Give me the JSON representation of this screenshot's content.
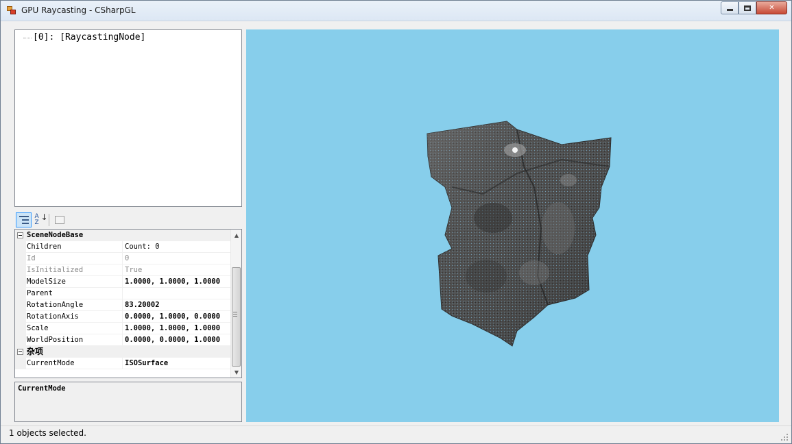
{
  "window": {
    "title": "GPU Raycasting - CSharpGL",
    "minimize_label": "",
    "maximize_label": "",
    "close_label": "✕"
  },
  "tree": {
    "node_label": "[0]: [RaycastingNode]"
  },
  "toolbar": {
    "categorized_icon": "categorized-icon",
    "alphabetical_icon": "alphabetical-sort-icon",
    "property_pages_icon": "property-pages-icon",
    "alphabetical_a": "A",
    "alphabetical_z": "Z",
    "alphabetical_arrow": "↓"
  },
  "property_grid": {
    "categories": [
      {
        "name": "SceneNodeBase",
        "rows": [
          {
            "name": "Children",
            "value": "Count: 0",
            "readonly": false,
            "bold": false
          },
          {
            "name": "Id",
            "value": "0",
            "readonly": true,
            "bold": false
          },
          {
            "name": "IsInitialized",
            "value": "True",
            "readonly": true,
            "bold": false
          },
          {
            "name": "ModelSize",
            "value": "1.0000, 1.0000, 1.0000",
            "readonly": false,
            "bold": true
          },
          {
            "name": "Parent",
            "value": "",
            "readonly": false,
            "bold": false
          },
          {
            "name": "RotationAngle",
            "value": "83.20002",
            "readonly": false,
            "bold": true
          },
          {
            "name": "RotationAxis",
            "value": "0.0000, 1.0000, 0.0000",
            "readonly": false,
            "bold": true
          },
          {
            "name": "Scale",
            "value": "1.0000, 1.0000, 1.0000",
            "readonly": false,
            "bold": true
          },
          {
            "name": "WorldPosition",
            "value": "0.0000, 0.0000, 1.0000",
            "readonly": false,
            "bold": true
          }
        ]
      },
      {
        "name": "杂项",
        "rows": [
          {
            "name": "CurrentMode",
            "value": "ISOSurface",
            "readonly": false,
            "bold": true
          }
        ]
      }
    ],
    "scroll_up_label": "▲",
    "scroll_down_label": "▼"
  },
  "description": {
    "title": "CurrentMode"
  },
  "viewport": {
    "background": "#87ceeb",
    "model_color": "#5a5a5a",
    "model_name": "iso-surface-volume-render"
  },
  "status": {
    "text": "1 objects selected."
  }
}
